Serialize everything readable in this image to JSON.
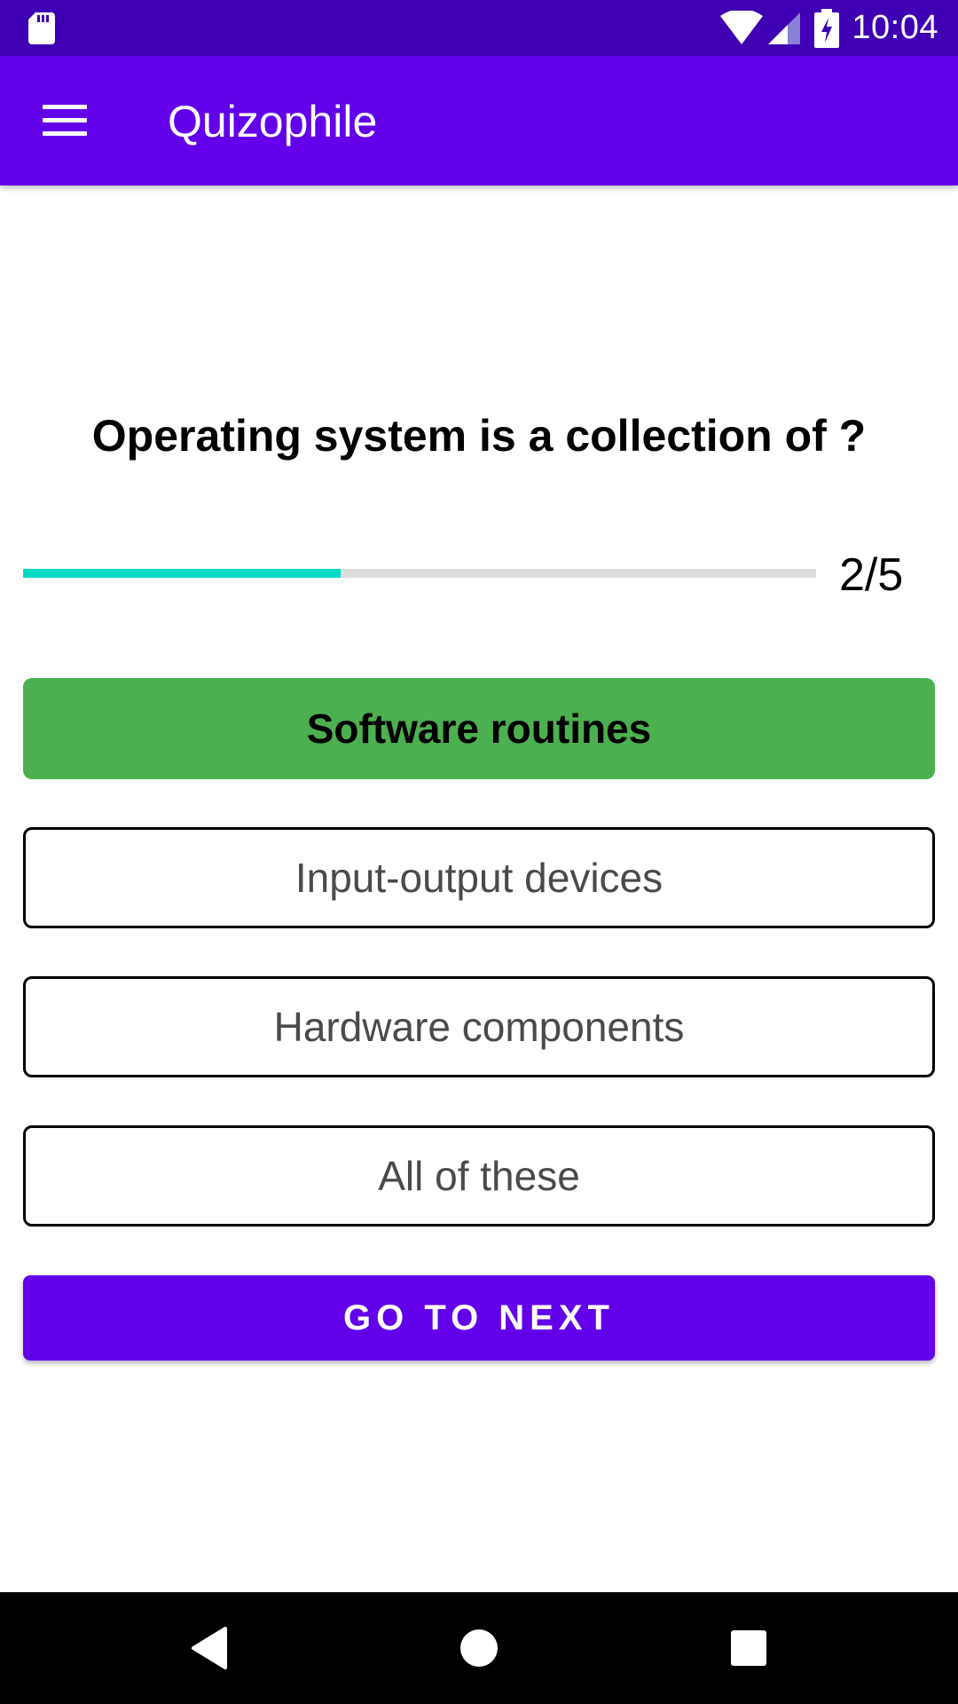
{
  "status_bar": {
    "time": "10:04"
  },
  "app_bar": {
    "title": "Quizophile"
  },
  "quiz": {
    "question": "Operating system is a collection of ?",
    "progress": {
      "current": 2,
      "total": 5,
      "fraction_filled": 0.4,
      "label": "2/5"
    },
    "options": [
      {
        "label": "Software routines",
        "selected": true
      },
      {
        "label": "Input-output devices",
        "selected": false
      },
      {
        "label": "Hardware components",
        "selected": false
      },
      {
        "label": "All of these",
        "selected": false
      }
    ],
    "next_label": "GO TO NEXT"
  },
  "colors": {
    "status_bar": "#3f00b3",
    "app_bar": "#6200ea",
    "progress_fill": "#03dac5",
    "selected_option": "#4caf50",
    "next_button": "#6200ea"
  },
  "icons": [
    "sd-card-icon",
    "wifi-icon",
    "signal-icon",
    "battery-charging-icon",
    "menu-icon",
    "back-icon",
    "home-icon",
    "recents-icon"
  ]
}
